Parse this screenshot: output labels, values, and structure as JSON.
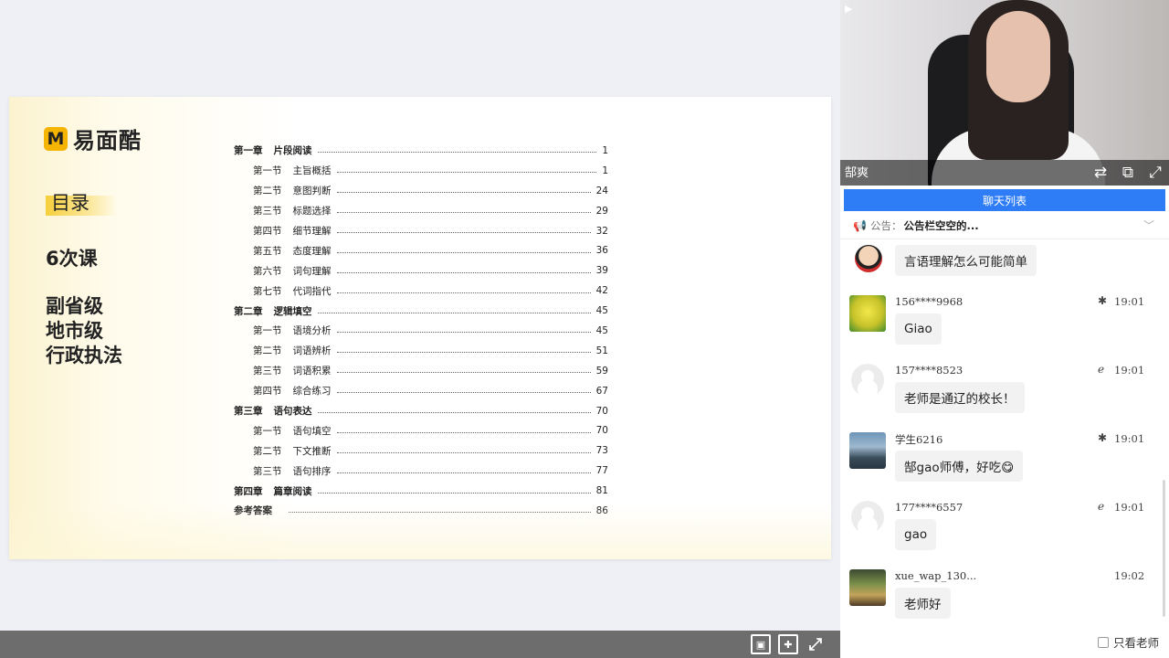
{
  "slide": {
    "logo_mark": "M",
    "logo_text": "易面酷",
    "mulu": "目录",
    "lessons": "6次课",
    "levels": [
      "副省级",
      "地市级",
      "行政执法"
    ],
    "toc": [
      {
        "type": "chapter",
        "no": "第一章",
        "title": "片段阅读",
        "page": "1"
      },
      {
        "type": "section",
        "no": "第一节",
        "title": "主旨概括",
        "page": "1"
      },
      {
        "type": "section",
        "no": "第二节",
        "title": "意图判断",
        "page": "24"
      },
      {
        "type": "section",
        "no": "第三节",
        "title": "标题选择",
        "page": "29"
      },
      {
        "type": "section",
        "no": "第四节",
        "title": "细节理解",
        "page": "32"
      },
      {
        "type": "section",
        "no": "第五节",
        "title": "态度理解",
        "page": "36"
      },
      {
        "type": "section",
        "no": "第六节",
        "title": "词句理解",
        "page": "39"
      },
      {
        "type": "section",
        "no": "第七节",
        "title": "代词指代",
        "page": "42"
      },
      {
        "type": "chapter",
        "no": "第二章",
        "title": "逻辑填空",
        "page": "45"
      },
      {
        "type": "section",
        "no": "第一节",
        "title": "语境分析",
        "page": "45"
      },
      {
        "type": "section",
        "no": "第二节",
        "title": "词语辨析",
        "page": "51"
      },
      {
        "type": "section",
        "no": "第三节",
        "title": "词语积累",
        "page": "59"
      },
      {
        "type": "section",
        "no": "第四节",
        "title": "综合练习",
        "page": "67"
      },
      {
        "type": "chapter",
        "no": "第三章",
        "title": "语句表达",
        "page": "70"
      },
      {
        "type": "section",
        "no": "第一节",
        "title": "语句填空",
        "page": "70"
      },
      {
        "type": "section",
        "no": "第二节",
        "title": "下文推断",
        "page": "73"
      },
      {
        "type": "section",
        "no": "第三节",
        "title": "语句排序",
        "page": "77"
      },
      {
        "type": "chapter",
        "no": "第四章",
        "title": "篇章阅读",
        "page": "81"
      },
      {
        "type": "chapter",
        "no": "参考答案",
        "title": "",
        "page": "86"
      }
    ]
  },
  "toolbar": {
    "icons": [
      "fit-screen-icon",
      "fullscreen-window-icon",
      "expand-icon"
    ]
  },
  "video": {
    "teacher_name": "郜爽",
    "icons": [
      "switch-icon",
      "popout-icon",
      "expand-icon"
    ]
  },
  "chat": {
    "tab_label": "聊天列表",
    "notice_label": "公告：",
    "notice_text": "公告栏空空的...",
    "messages": [
      {
        "user": "",
        "device": "",
        "device_icon": "",
        "time": "",
        "text": "言语理解怎么可能简单",
        "avatar": "cartoon"
      },
      {
        "user": "156****9968",
        "device": "android-icon",
        "device_glyph": "✱",
        "time": "19:01",
        "text": "Giao",
        "avatar": "sponge"
      },
      {
        "user": "157****8523",
        "device": "ie-icon",
        "device_glyph": "ℯ",
        "time": "19:01",
        "text": "老师是通辽的校长！",
        "avatar": "default"
      },
      {
        "user": "学生6216",
        "device": "android-icon",
        "device_glyph": "✱",
        "time": "19:01",
        "text": "郜gao师傅，好吃😋",
        "avatar": "city"
      },
      {
        "user": "177****6557",
        "device": "ie-icon",
        "device_glyph": "ℯ",
        "time": "19:01",
        "text": "gao",
        "avatar": "default"
      },
      {
        "user": "xue_wap_130...",
        "device": "apple-icon",
        "device_glyph": "",
        "time": "19:02",
        "text": "老师好",
        "avatar": "green"
      }
    ],
    "only_teacher_label": "只看老师"
  },
  "colors": {
    "accent_blue": "#2f7df6",
    "logo_yellow": "#f5b400",
    "bottom_bar": "#6d6d6d"
  }
}
